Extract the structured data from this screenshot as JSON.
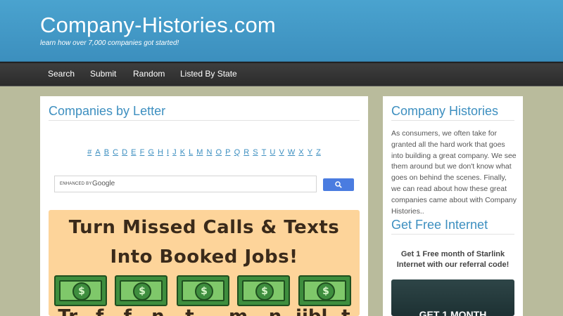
{
  "header": {
    "title": "Company-Histories.com",
    "tagline": "learn how over 7,000 companies got started!"
  },
  "nav": {
    "items": [
      "Search",
      "Submit",
      "Random",
      "Listed By State"
    ]
  },
  "main": {
    "title": "Companies by Letter",
    "letters": [
      "#",
      "A",
      "B",
      "C",
      "D",
      "E",
      "F",
      "G",
      "H",
      "I",
      "J",
      "K",
      "L",
      "M",
      "N",
      "O",
      "P",
      "Q",
      "R",
      "S",
      "T",
      "U",
      "V",
      "W",
      "X",
      "Y",
      "Z"
    ],
    "search": {
      "enhanced_label": "ENHANCED BY",
      "google_label": "Google",
      "value": ""
    },
    "ad": {
      "line1": "Turn Missed Calls & Texts",
      "line2": "Into Booked Jobs!",
      "money_symbol": "$",
      "bottom_partial": "Tr...f...f...n...t.....m...n..iibl..t"
    }
  },
  "sidebar": {
    "title": "Company Histories",
    "body": "As consumers, we often take for granted all the hard work that goes into building a great company. We see them around but we don't know what goes on behind the scenes. Finally, we can read about how these great companies came about with Company Histories..",
    "internet_title": "Get Free Internet",
    "internet_text": "Get 1 Free month of Starlink Internet with our referral code!",
    "promo_text": "GET 1 MONTH"
  },
  "colors": {
    "header": "#4aa3cf",
    "nav": "#333333",
    "background": "#b9bb9c",
    "accent": "#3d8fc0",
    "ad_bg": "#fdd49a"
  }
}
